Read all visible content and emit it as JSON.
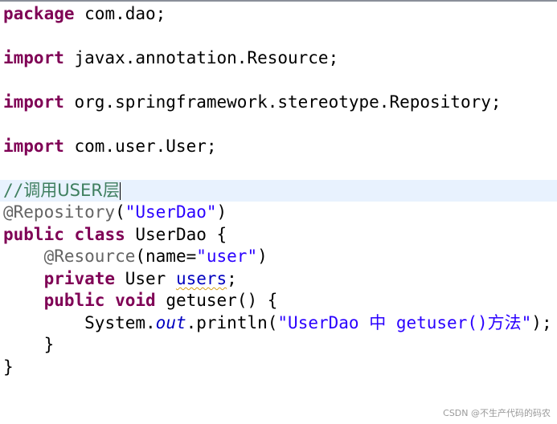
{
  "colors": {
    "keyword": "#7f0055",
    "string": "#2a00ff",
    "annotation": "#646464",
    "comment": "#3f7f5f",
    "field": "#0000c0",
    "current_line": "#e8f2fe",
    "warning_underline": "#d4a017"
  },
  "code": {
    "l1_kw": "package",
    "l1_rest": " com.dao;",
    "l2_kw": "import",
    "l2_rest": " javax.annotation.Resource;",
    "l3_kw": "import",
    "l3_rest": " org.springframework.stereotype.Repository;",
    "l4_kw": "import",
    "l4_rest": " com.user.User;",
    "l5_comment_prefix": "//",
    "l5_comment_cjk1": "调用",
    "l5_comment_latin": "USER",
    "l5_comment_cjk2": "层",
    "l6_ann": "@Repository",
    "l6_open": "(",
    "l6_str": "\"UserDao\"",
    "l6_close": ")",
    "l7_kw1": "public",
    "l7_kw2": "class",
    "l7_rest": " UserDao {",
    "l8_indent": "    ",
    "l8_ann": "@Resource",
    "l8_open": "(name=",
    "l8_str": "\"user\"",
    "l8_close": ")",
    "l9_indent": "    ",
    "l9_kw": "private",
    "l9_type": " User ",
    "l9_field": "users",
    "l9_semi": ";",
    "l10_indent": "    ",
    "l10_kw1": "public",
    "l10_kw2": "void",
    "l10_rest": " getuser() {",
    "l11_indent": "        ",
    "l11_sys": "System.",
    "l11_out": "out",
    "l11_println": ".println(",
    "l11_str_a": "\"UserDao ",
    "l11_str_cjk1": "中",
    "l11_str_b": " getuser()",
    "l11_str_cjk2": "方法",
    "l11_str_c": "\"",
    "l11_end": ");",
    "l12_text": "    }",
    "l13_text": "}"
  },
  "watermark": "CSDN @不生产代码的码农"
}
